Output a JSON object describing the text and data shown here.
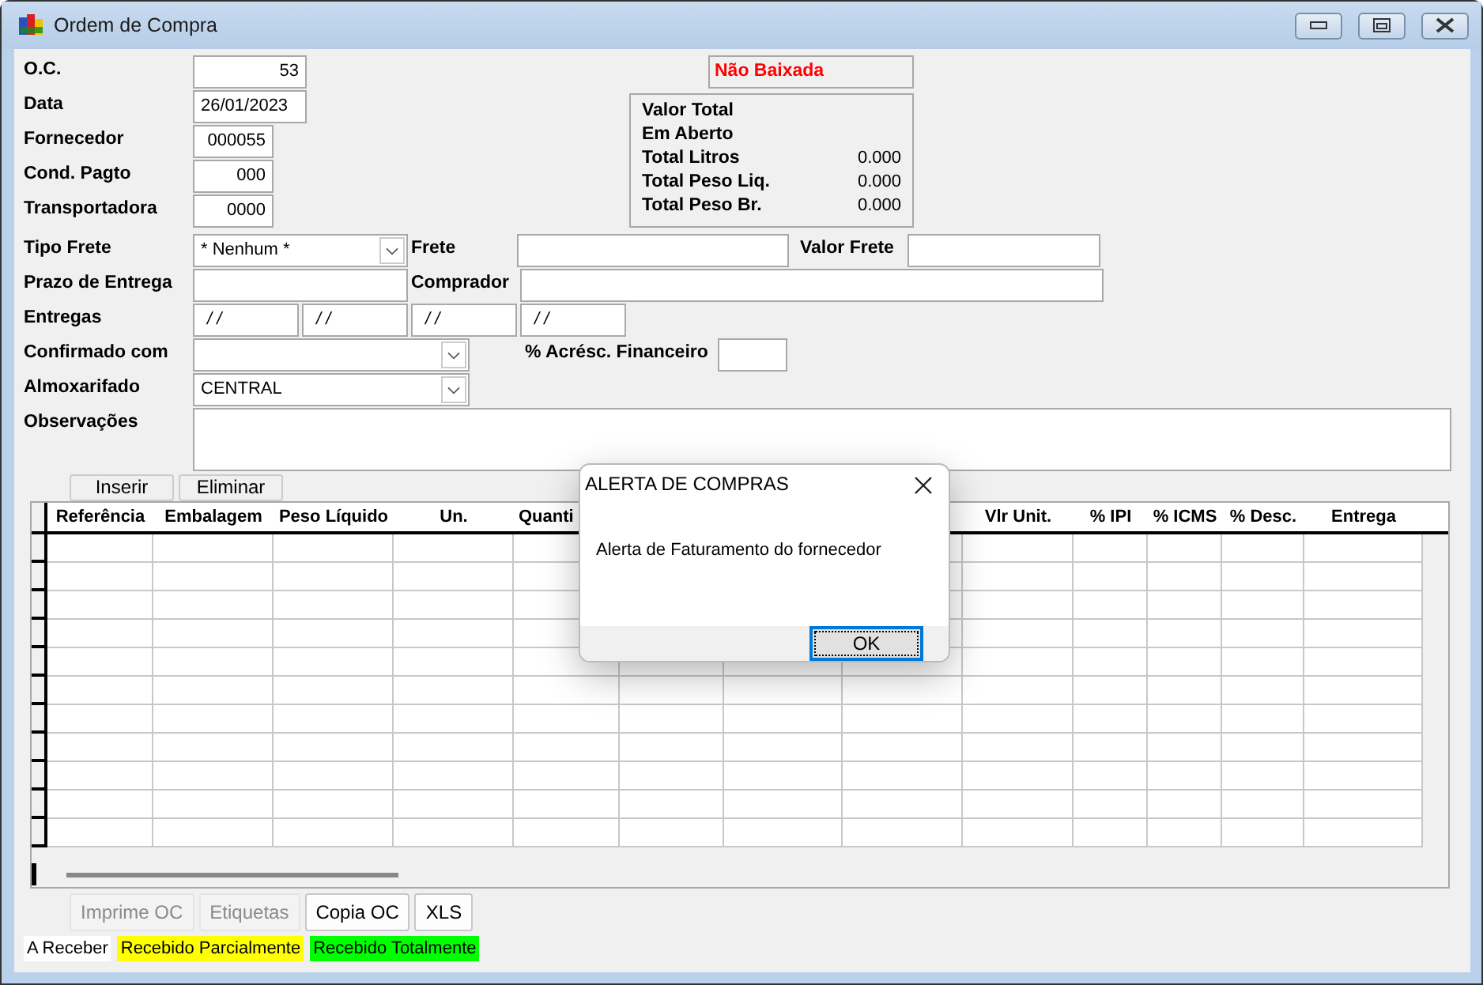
{
  "window": {
    "title": "Ordem de Compra"
  },
  "status": {
    "text": "Não Baixada"
  },
  "summary": [
    {
      "label": "Valor Total"
    },
    {
      "label": "Em Aberto"
    },
    {
      "label": "Total Litros",
      "value": "0.000"
    },
    {
      "label": "Total Peso Liq.",
      "value": "0.000"
    },
    {
      "label": "Total Peso Br.",
      "value": "0.000"
    }
  ],
  "top_fields": [
    {
      "label": "O.C.",
      "value": "53",
      "kind": "number"
    },
    {
      "label": "Data",
      "value": "26/01/2023",
      "kind": "date"
    },
    {
      "label": "Fornecedor",
      "value": "000055",
      "kind": "number"
    },
    {
      "label": "Cond. Pagto",
      "value": "000",
      "kind": "number"
    },
    {
      "label": "Transportadora",
      "value": "0000",
      "kind": "number"
    }
  ],
  "tipo_frete": {
    "label": "Tipo Frete",
    "value": "* Nenhum *"
  },
  "frete": {
    "label": "Frete"
  },
  "valor_frete": {
    "label": "Valor Frete"
  },
  "prazo_entrega": {
    "label": "Prazo de Entrega"
  },
  "comprador": {
    "label": "Comprador"
  },
  "entregas": {
    "label": "Entregas",
    "values": [
      "/ /",
      "/ /",
      "/ /",
      "/ /"
    ]
  },
  "confirmado_com": {
    "label": "Confirmado com"
  },
  "acresc_financeiro": {
    "label": "% Acrésc. Financeiro"
  },
  "almoxarifado": {
    "label": "Almoxarifado",
    "value": "CENTRAL"
  },
  "observacoes": {
    "label": "Observações"
  },
  "grid_buttons": [
    "Inserir",
    "Eliminar"
  ],
  "table": {
    "columns": [
      {
        "label": "Referência"
      },
      {
        "label": "Embalagem"
      },
      {
        "label": "Peso Líquido"
      },
      {
        "label": "Un."
      },
      {
        "label": "Quanti"
      },
      {},
      {},
      {},
      {
        "label": "Vlr Unit."
      },
      {
        "label": "% IPI"
      },
      {
        "label": "% ICMS"
      },
      {
        "label": "% Desc."
      },
      {
        "label": "Entrega"
      }
    ]
  },
  "bottom_buttons": [
    {
      "label": "Imprime OC",
      "disabled": true
    },
    {
      "label": "Etiquetas",
      "disabled": true
    },
    {
      "label": "Copia OC",
      "disabled": false
    },
    {
      "label": "XLS",
      "disabled": false
    }
  ],
  "legend": [
    {
      "label": "A Receber",
      "color": "#ffffff"
    },
    {
      "label": "Recebido Parcialmente",
      "color": "#ffff00"
    },
    {
      "label": "Recebido Totalmente",
      "color": "#00ff00"
    }
  ],
  "dialog": {
    "title": "ALERTA DE COMPRAS",
    "message": "Alerta de Faturamento do fornecedor",
    "button": "OK"
  }
}
